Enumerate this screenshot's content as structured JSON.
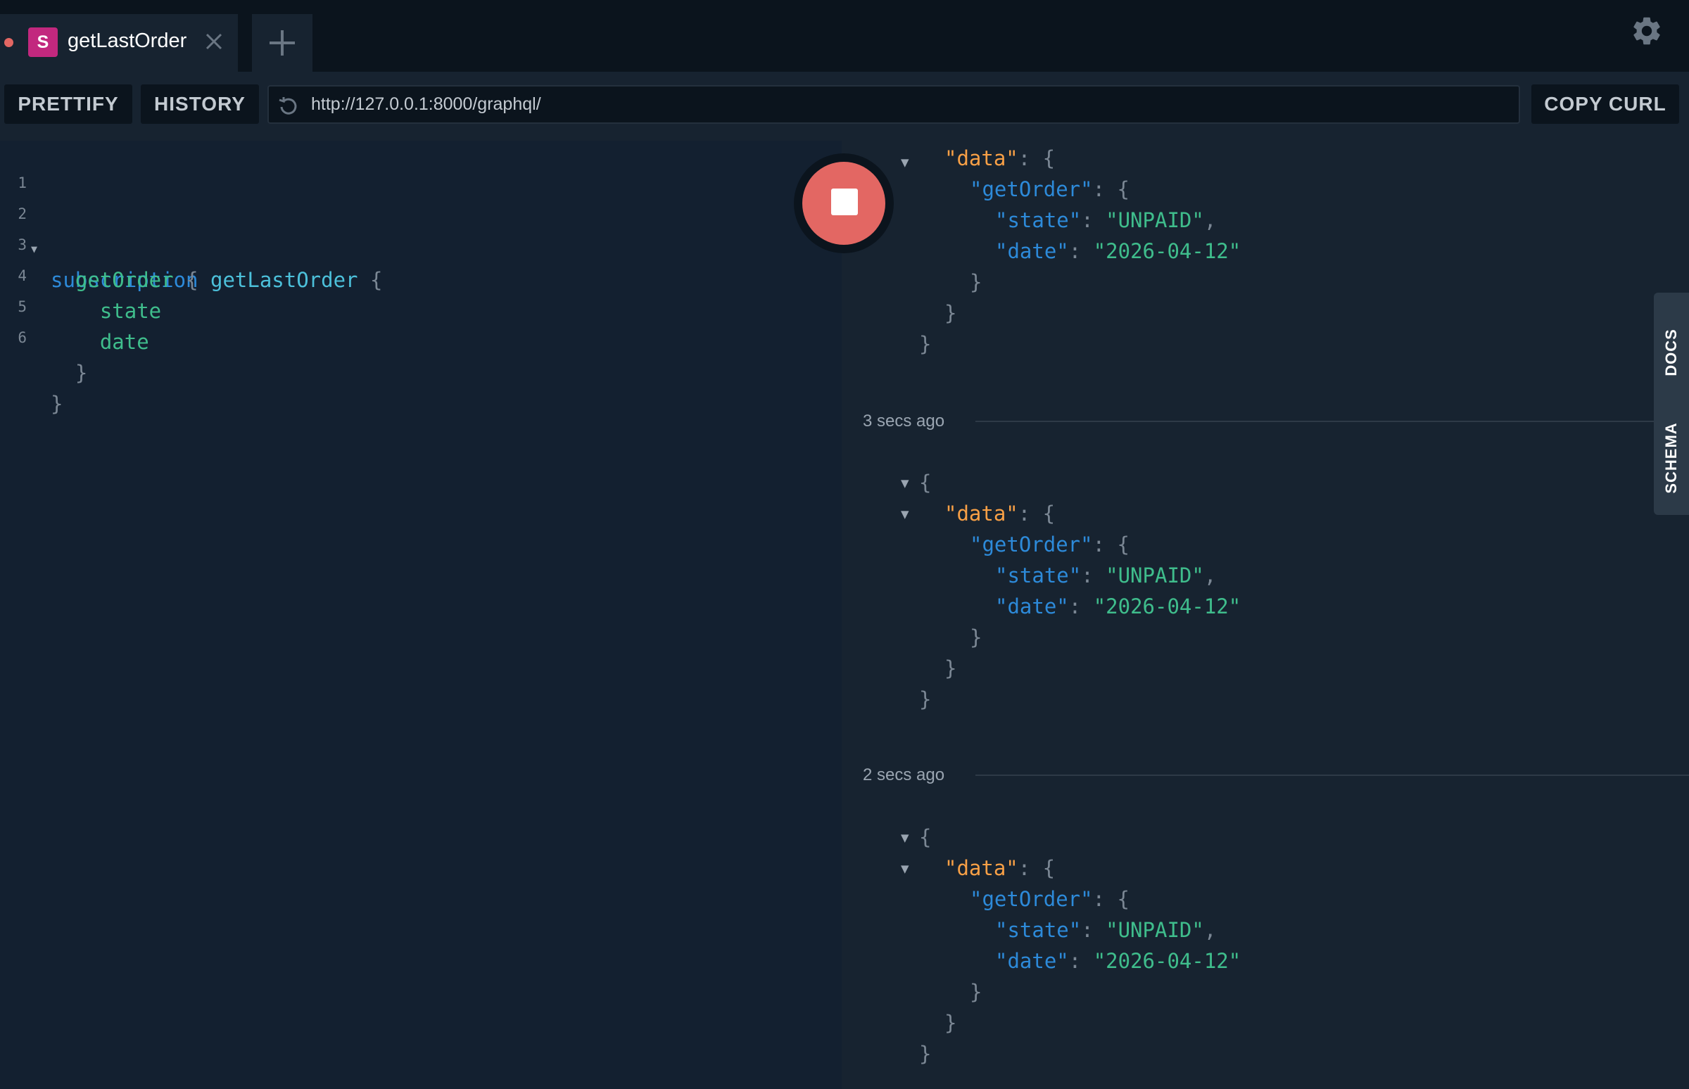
{
  "tab": {
    "badge": "S",
    "title": "getLastOrder"
  },
  "toolbar": {
    "prettify_label": "PRETTIFY",
    "history_label": "HISTORY",
    "copy_curl_label": "COPY CURL"
  },
  "url": {
    "value": "http://127.0.0.1:8000/graphql/"
  },
  "editor": {
    "lines": [
      {
        "num": "1",
        "tokens": [
          "subscription",
          "getLastOrder",
          "{"
        ]
      },
      {
        "num": "2",
        "tokens": [
          "getOrder",
          "{"
        ]
      },
      {
        "num": "3",
        "tokens": [
          "state"
        ]
      },
      {
        "num": "4",
        "tokens": [
          "date"
        ]
      },
      {
        "num": "5",
        "tokens": [
          "}"
        ]
      },
      {
        "num": "6",
        "tokens": [
          "}"
        ]
      }
    ]
  },
  "results": {
    "open_brace": "{",
    "close_brace": "}",
    "data_key": "\"data\"",
    "get_order_key": "\"getOrder\"",
    "state_key": "\"state\"",
    "state_value": "\"UNPAID\"",
    "date_key": "\"date\"",
    "date_value": "\"2026-04-12\"",
    "colon_brace": ": {",
    "colon": ": ",
    "comma": ",",
    "timestamps": [
      "3 secs ago",
      "2 secs ago"
    ]
  },
  "side_tabs": {
    "docs": "DOCS",
    "schema": "SCHEMA"
  },
  "colors": {
    "accent_run": "#e36763",
    "badge": "#c2287e",
    "keyword": "#2d8ad9",
    "field": "#3fbd8c",
    "data_key": "#f8a046"
  },
  "icons": {
    "close": "close-icon",
    "add": "plus-icon",
    "settings": "gear-icon",
    "reload": "reload-icon",
    "run": "stop-icon"
  }
}
